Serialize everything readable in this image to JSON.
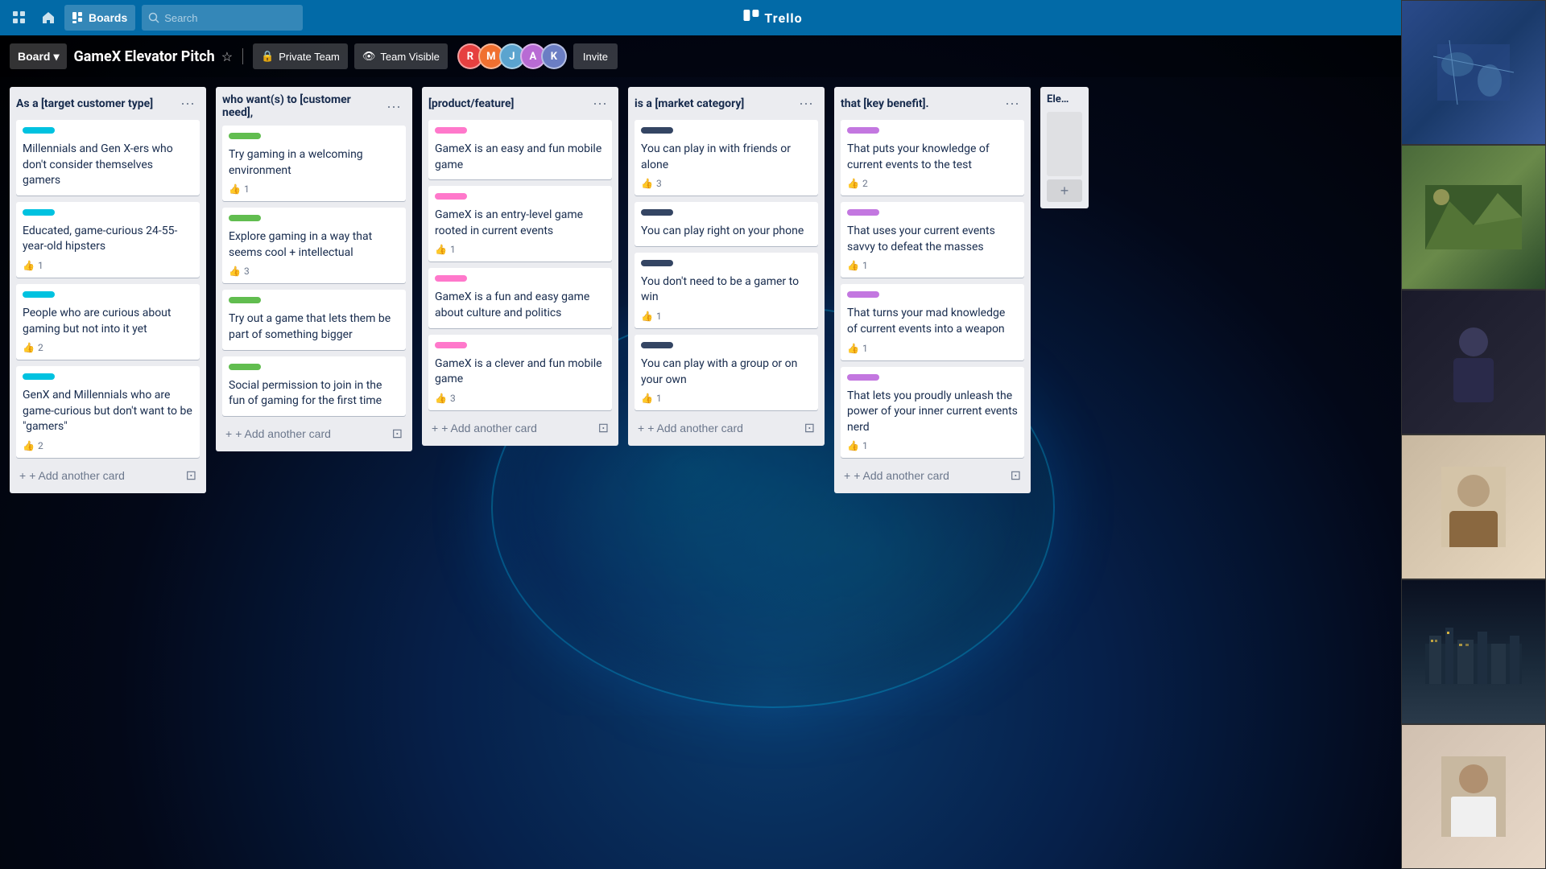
{
  "app": {
    "name": "Trello",
    "logo_symbol": "▣"
  },
  "nav": {
    "boards_label": "Boards",
    "search_placeholder": "Search",
    "grid_icon": "⊞",
    "home_icon": "⌂",
    "search_icon": "🔍"
  },
  "board_header": {
    "board_label": "Board",
    "board_chevron": "▾",
    "title": "GameX Elevator Pitch",
    "star_icon": "☆",
    "private_team_label": "Private Team",
    "lock_icon": "🔒",
    "team_visible_label": "Team Visible",
    "eye_icon": "👁",
    "invite_label": "Invite"
  },
  "avatars": [
    {
      "bg": "#E64040",
      "letter": "R"
    },
    {
      "bg": "#F07030",
      "letter": "M"
    },
    {
      "bg": "#5BA4CF",
      "letter": "J"
    },
    {
      "bg": "#B86BD4",
      "letter": "A"
    },
    {
      "bg": "#6B7EC4",
      "letter": "K"
    }
  ],
  "lists": [
    {
      "id": "list-1",
      "title": "As a [target customer type]",
      "cards": [
        {
          "id": "c1-1",
          "label_color": "cyan",
          "text": "Millennials and Gen X-ers who don't consider themselves gamers",
          "votes": null
        },
        {
          "id": "c1-2",
          "label_color": "cyan",
          "text": "Educated, game-curious 24-55-year-old hipsters",
          "votes": 1
        },
        {
          "id": "c1-3",
          "label_color": "cyan",
          "text": "People who are curious about gaming but not into it yet",
          "votes": 2
        },
        {
          "id": "c1-4",
          "label_color": "cyan",
          "text": "GenX and Millennials who are game-curious but don't want to be \"gamers\"",
          "votes": 2
        }
      ],
      "add_card_label": "+ Add another card"
    },
    {
      "id": "list-2",
      "title": "who want(s) to [customer need],",
      "cards": [
        {
          "id": "c2-1",
          "label_color": "green",
          "text": "Try gaming in a welcoming environment",
          "votes": 1
        },
        {
          "id": "c2-2",
          "label_color": "green",
          "text": "Explore gaming in a way that seems cool + intellectual",
          "votes": 3
        },
        {
          "id": "c2-3",
          "label_color": "green",
          "text": "Try out a game that lets them be part of something bigger",
          "votes": null
        },
        {
          "id": "c2-4",
          "label_color": "green",
          "text": "Social permission to join in the fun of gaming for the first time",
          "votes": null
        }
      ],
      "add_card_label": "+ Add another card"
    },
    {
      "id": "list-3",
      "title": "[product/feature]",
      "cards": [
        {
          "id": "c3-1",
          "label_color": "pink",
          "text": "GameX is an easy and fun mobile game",
          "votes": null
        },
        {
          "id": "c3-2",
          "label_color": "pink",
          "text": "GameX is an entry-level game rooted in current events",
          "votes": 1
        },
        {
          "id": "c3-3",
          "label_color": "pink",
          "text": "GameX is a fun and easy game about culture and politics",
          "votes": null
        },
        {
          "id": "c3-4",
          "label_color": "pink",
          "text": "GameX is a clever and fun mobile game",
          "votes": 3
        }
      ],
      "add_card_label": "+ Add another card"
    },
    {
      "id": "list-4",
      "title": "is a [market category]",
      "cards": [
        {
          "id": "c4-1",
          "label_color": "dark-blue",
          "text": "You can play in with friends or alone",
          "votes": 3
        },
        {
          "id": "c4-2",
          "label_color": "dark-blue",
          "text": "You can play right on your phone",
          "votes": null
        },
        {
          "id": "c4-3",
          "label_color": "dark-blue",
          "text": "You don't need to be a gamer to win",
          "votes": 1
        },
        {
          "id": "c4-4",
          "label_color": "dark-blue",
          "text": "You can play with a group or on your own",
          "votes": 1
        }
      ],
      "add_card_label": "+ Add another card"
    },
    {
      "id": "list-5",
      "title": "that [key benefit].",
      "cards": [
        {
          "id": "c5-1",
          "label_color": "purple",
          "text": "That puts your knowledge of current events to the test",
          "votes": 2
        },
        {
          "id": "c5-2",
          "label_color": "purple",
          "text": "That uses your current events savvy to defeat the masses",
          "votes": 1
        },
        {
          "id": "c5-3",
          "label_color": "purple",
          "text": "That turns your mad knowledge of current events into a weapon",
          "votes": 1
        },
        {
          "id": "c5-4",
          "label_color": "purple",
          "text": "That lets you proudly unleash the power of your inner current events nerd",
          "votes": 1
        }
      ],
      "add_card_label": "+ Add another card"
    },
    {
      "id": "list-6",
      "title": "Ele…",
      "cards": [],
      "partial": true
    }
  ],
  "video_tiles": [
    {
      "id": "vt-1",
      "style": "map",
      "label": "Map view"
    },
    {
      "id": "vt-2",
      "style": "mountain",
      "label": "Mountain scene"
    },
    {
      "id": "vt-3",
      "style": "dark",
      "label": "Person dark room"
    },
    {
      "id": "vt-4",
      "style": "person",
      "label": "Person light"
    },
    {
      "id": "vt-5",
      "style": "city",
      "label": "City night"
    },
    {
      "id": "vt-6",
      "style": "person2",
      "label": "Person 2"
    }
  ],
  "vote_icon": "👍",
  "menu_icon": "•••",
  "plus_icon": "+",
  "archive_icon": "⊡"
}
